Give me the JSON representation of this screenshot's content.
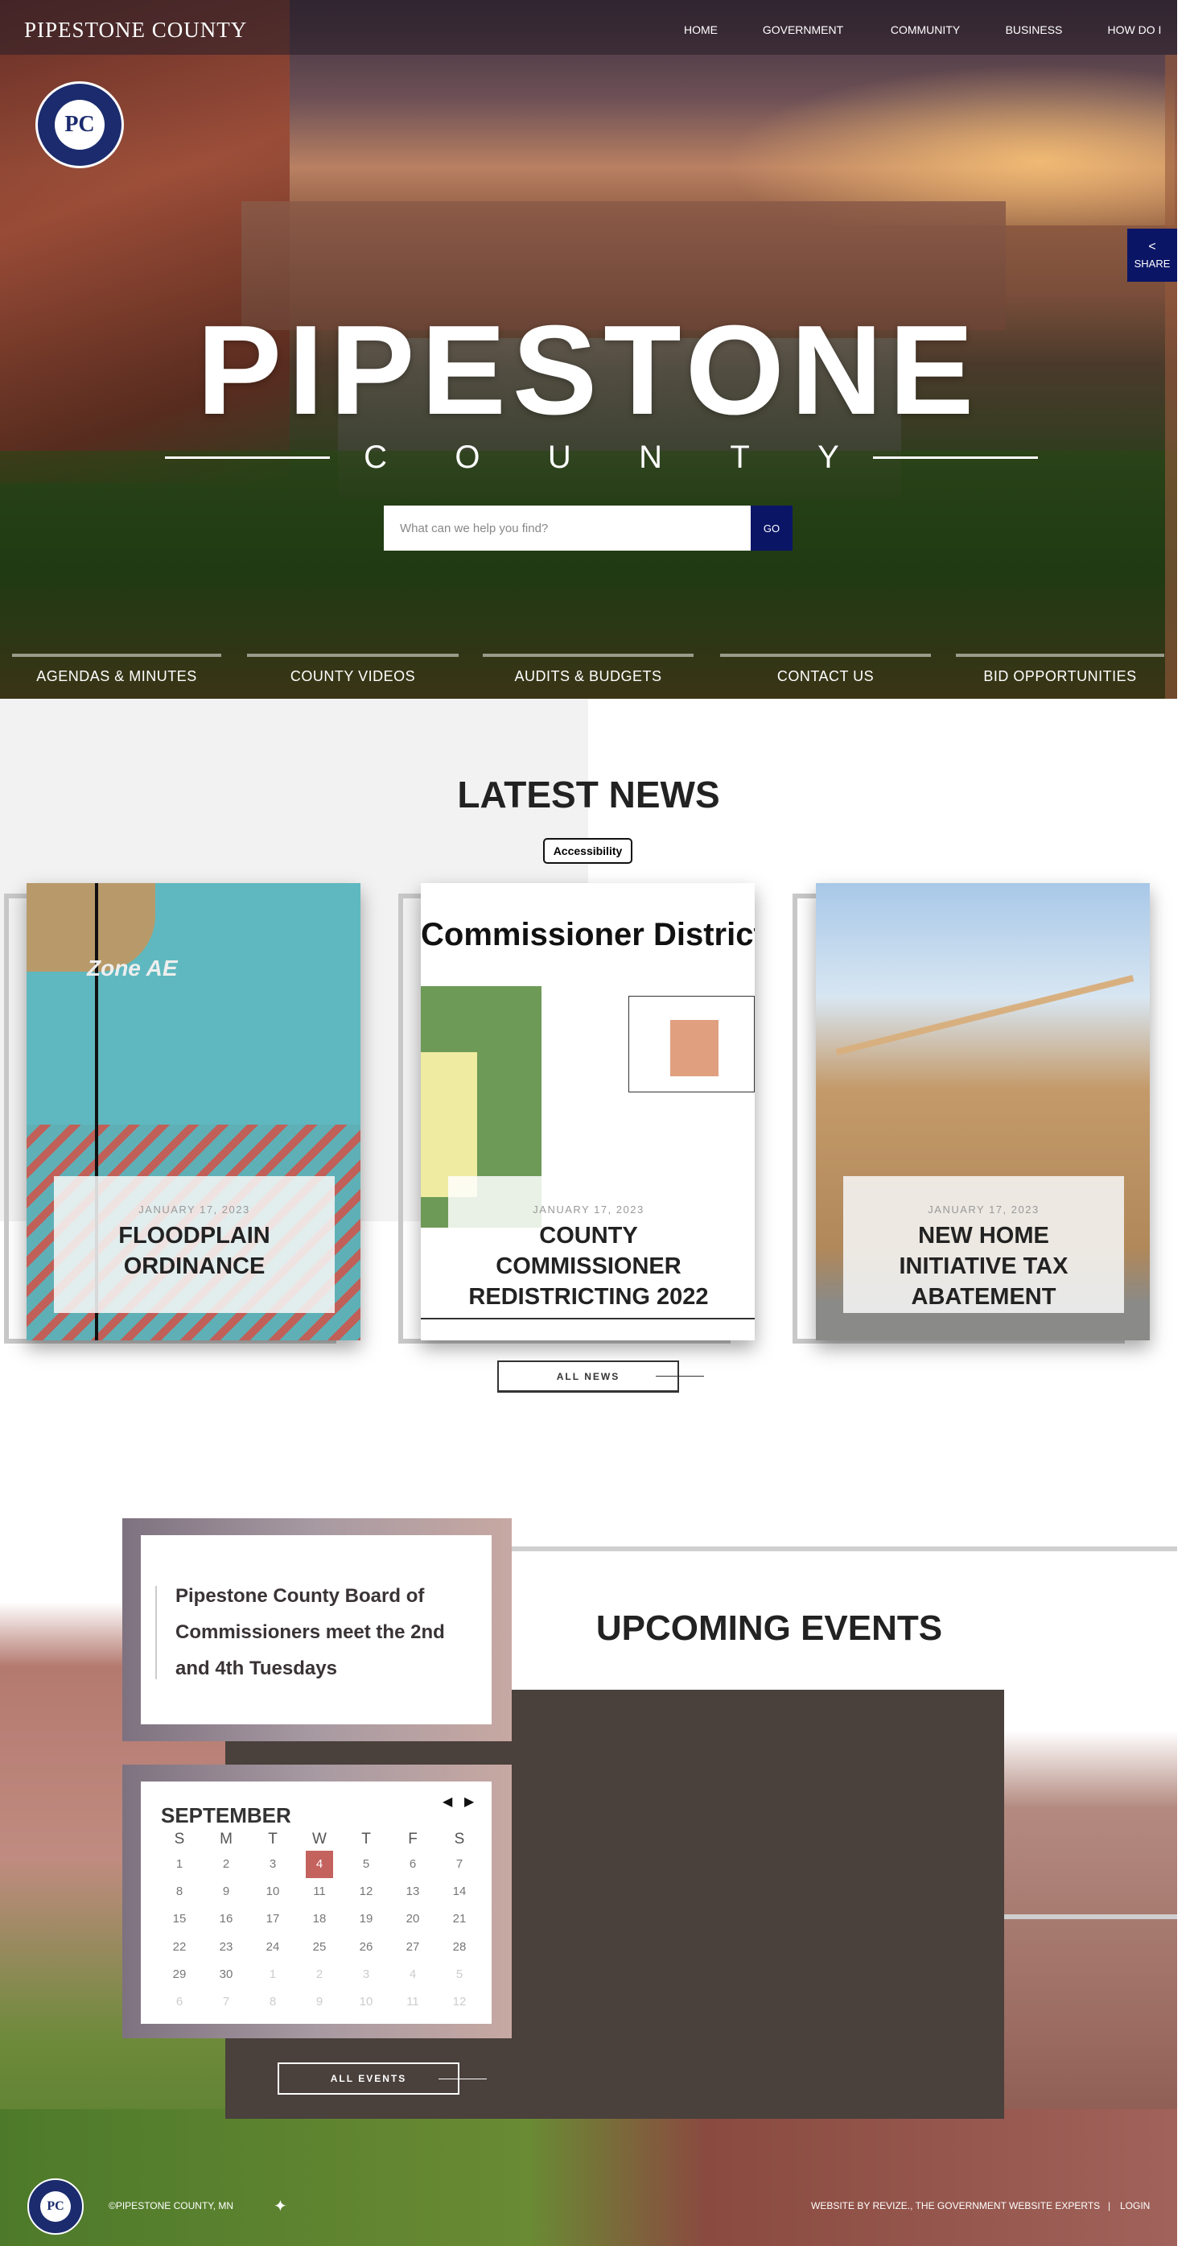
{
  "header": {
    "site_title": "PIPESTONE COUNTY",
    "nav": [
      "HOME",
      "GOVERNMENT",
      "COMMUNITY",
      "BUSINESS",
      "HOW DO I"
    ],
    "seal_text": "PIPESTONE COUNTY",
    "seal_initials": "PC",
    "share_label": "SHARE"
  },
  "hero": {
    "title": "PIPESTONE",
    "subtitle_letters": [
      "C",
      "O",
      "U",
      "N",
      "T",
      "Y"
    ],
    "search_placeholder": "What can we help you find?",
    "search_button": "GO",
    "quick_links": [
      "AGENDAS & MINUTES",
      "COUNTY VIDEOS",
      "AUDITS & BUDGETS",
      "CONTACT US",
      "BID OPPORTUNITIES"
    ]
  },
  "news": {
    "title": "LATEST NEWS",
    "accessibility_label": "Accessibility",
    "all_label": "ALL NEWS",
    "items": [
      {
        "date": "JANUARY 17, 2023",
        "title": "FLOODPLAIN ORDINANCE",
        "image_text": "Zone AE"
      },
      {
        "date": "JANUARY 17, 2023",
        "title": "COUNTY COMMISSIONER REDISTRICTING 2022",
        "image_text": "Commissioner Districts"
      },
      {
        "date": "JANUARY 17, 2023",
        "title": "NEW HOME INITIATIVE TAX ABATEMENT"
      }
    ]
  },
  "events": {
    "title": "UPCOMING EVENTS",
    "announcement": "Pipestone County Board of Commissioners meet the 2nd and 4th Tuesdays",
    "all_label": "ALL EVENTS",
    "calendar": {
      "month": "SEPTEMBER",
      "weekdays": [
        "S",
        "M",
        "T",
        "W",
        "T",
        "F",
        "S"
      ],
      "today": 4,
      "weeks": [
        [
          1,
          2,
          3,
          4,
          5,
          6,
          7
        ],
        [
          8,
          9,
          10,
          11,
          12,
          13,
          14
        ],
        [
          15,
          16,
          17,
          18,
          19,
          20,
          21
        ],
        [
          22,
          23,
          24,
          25,
          26,
          27,
          28
        ],
        [
          29,
          30,
          1,
          2,
          3,
          4,
          5
        ],
        [
          6,
          7,
          8,
          9,
          10,
          11,
          12
        ]
      ]
    },
    "accent": "#c4625e"
  },
  "footer": {
    "copyright": "©PIPESTONE COUNTY, MN",
    "credit": "WEBSITE BY REVIZE., THE GOVERNMENT WEBSITE EXPERTS",
    "separator": "|",
    "login": "LOGIN"
  },
  "colors": {
    "brand_navy": "#0b1566",
    "events_panel": "#4a403c"
  }
}
